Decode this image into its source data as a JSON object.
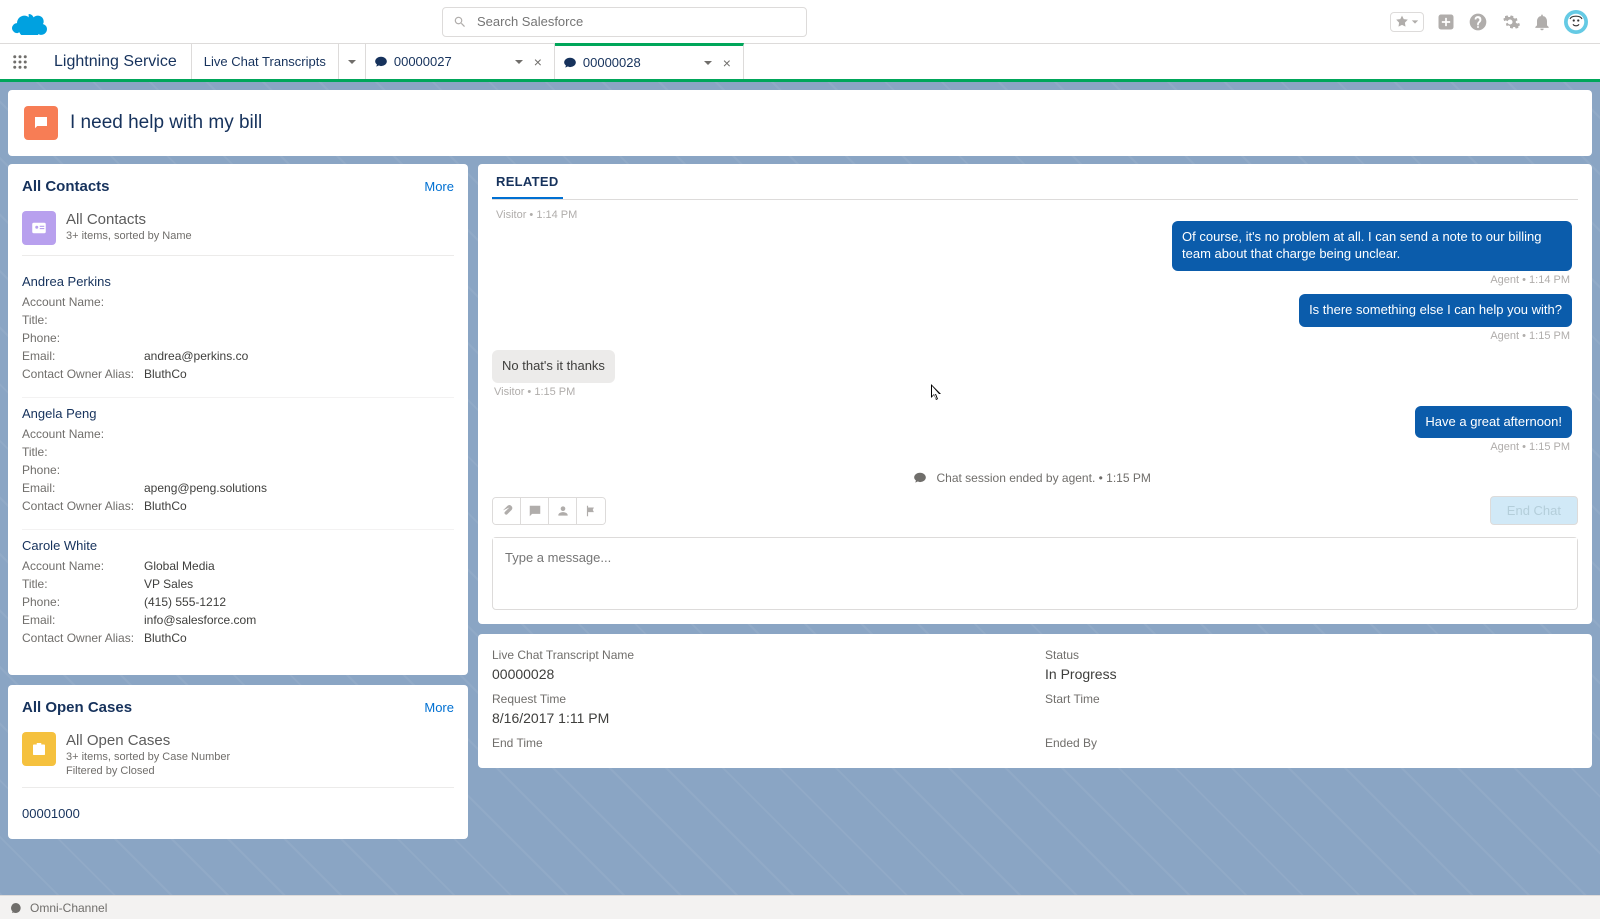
{
  "header": {
    "search_placeholder": "Search Salesforce"
  },
  "app": {
    "name": "Lightning Service"
  },
  "nav": {
    "list_tab": "Live Chat Transcripts",
    "rec_tab_1": "00000027",
    "rec_tab_2": "00000028"
  },
  "page": {
    "title": "I need help with my bill"
  },
  "contacts_card": {
    "title": "All Contacts",
    "more": "More",
    "list_title": "All Contacts",
    "list_sub": "3+ items, sorted by Name",
    "labels": {
      "account": "Account Name:",
      "title": "Title:",
      "phone": "Phone:",
      "email": "Email:",
      "owner": "Contact Owner Alias:"
    },
    "items": [
      {
        "name": "Andrea Perkins",
        "account": "",
        "title": "",
        "phone": "",
        "email": "andrea@perkins.co",
        "owner": "BluthCo"
      },
      {
        "name": "Angela Peng",
        "account": "",
        "title": "",
        "phone": "",
        "email": "apeng@peng.solutions",
        "owner": "BluthCo"
      },
      {
        "name": "Carole White",
        "account": "Global Media",
        "title": "VP Sales",
        "phone": "(415) 555-1212",
        "email": "info@salesforce.com",
        "owner": "BluthCo"
      }
    ]
  },
  "cases_card": {
    "title": "All Open Cases",
    "more": "More",
    "list_title": "All Open Cases",
    "list_sub1": "3+ items, sorted by Case Number",
    "list_sub2": "Filtered by Closed",
    "first_case": "00001000"
  },
  "related": {
    "tab": "RELATED"
  },
  "chat": {
    "top_meta": "Visitor • 1:14 PM",
    "msgs": [
      {
        "side": "agent",
        "text": "Of course, it's no problem at all. I can send a note to our billing team about that charge being unclear.",
        "meta": "Agent • 1:14 PM"
      },
      {
        "side": "agent",
        "text": "Is there something else I can help you with?",
        "meta": "Agent • 1:15 PM"
      },
      {
        "side": "visitor",
        "text": "No that's it thanks",
        "meta": "Visitor • 1:15 PM"
      },
      {
        "side": "agent",
        "text": "Have a great afternoon!",
        "meta": "Agent • 1:15 PM"
      }
    ],
    "ended": "Chat session ended by agent. • 1:15 PM",
    "end_btn": "End Chat",
    "input_placeholder": "Type a message..."
  },
  "detail": {
    "name_lbl": "Live Chat Transcript Name",
    "name_val": "00000028",
    "status_lbl": "Status",
    "status_val": "In Progress",
    "req_lbl": "Request Time",
    "req_val": "8/16/2017 1:11 PM",
    "start_lbl": "Start Time",
    "start_val": "",
    "end_lbl": "End Time",
    "end_val": "",
    "endedby_lbl": "Ended By",
    "endedby_val": ""
  },
  "footer": {
    "omni": "Omni-Channel"
  }
}
